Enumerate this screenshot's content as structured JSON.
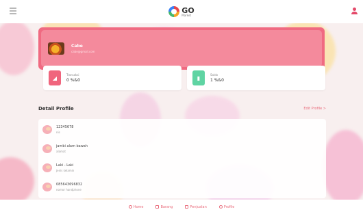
{
  "header": {
    "logo_text": "GO",
    "logo_sub": "Market"
  },
  "profile": {
    "name": "Cabe",
    "email": "cabe@gmail.com"
  },
  "stats": [
    {
      "label": "Transaksi",
      "value": "0 %&0",
      "icon": "cart-icon",
      "color": "#f0657d"
    },
    {
      "label": "Saldo",
      "value": "1 %&0",
      "icon": "wallet-icon",
      "color": "#5fd4a3"
    }
  ],
  "detail": {
    "title": "Detail Profile",
    "edit_label": "Edit Profile >",
    "rows": [
      {
        "value": "12345678",
        "label": "nis"
      },
      {
        "value": "jambi alam bawah",
        "label": "alamat"
      },
      {
        "value": "Laki - Laki",
        "label": "jenis kelamin"
      },
      {
        "value": "085643696832",
        "label": "nomor handphone"
      }
    ]
  },
  "nav": [
    {
      "label": "Home",
      "icon": "home-icon"
    },
    {
      "label": "Barang",
      "icon": "box-icon"
    },
    {
      "label": "Penjualan",
      "icon": "cart-icon"
    },
    {
      "label": "Profile",
      "icon": "user-icon"
    }
  ]
}
